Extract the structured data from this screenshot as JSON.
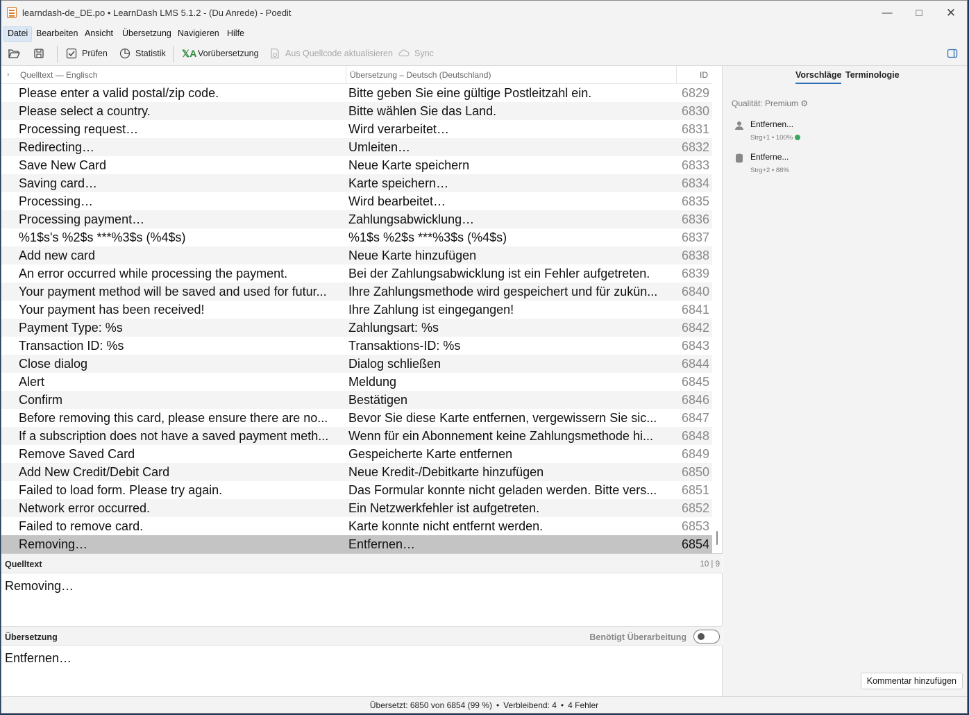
{
  "window": {
    "title": "learndash-de_DE.po • LearnDash LMS 5.1.2 - (Du Anrede) - Poedit"
  },
  "menu": [
    "Datei",
    "Bearbeiten",
    "Ansicht",
    "Übersetzung",
    "Navigieren",
    "Hilfe"
  ],
  "toolbar": {
    "validate": "Prüfen",
    "stats": "Statistik",
    "pretranslate": "Vorübersetzung",
    "update_from_code": "Aus Quellcode aktualisieren",
    "sync": "Sync"
  },
  "list": {
    "col_source": "Quelltext — Englisch",
    "col_translation": "Übersetzung – Deutsch (Deutschland)",
    "col_id": "ID",
    "rows": [
      {
        "source": "Please enter a valid postal/zip code.",
        "translation": "Bitte geben Sie eine gültige Postleitzahl ein.",
        "id": "6829"
      },
      {
        "source": "Please select a country.",
        "translation": "Bitte wählen Sie das Land.",
        "id": "6830"
      },
      {
        "source": "Processing request…",
        "translation": "Wird verarbeitet…",
        "id": "6831"
      },
      {
        "source": "Redirecting…",
        "translation": "Umleiten…",
        "id": "6832"
      },
      {
        "source": "Save New Card",
        "translation": "Neue Karte speichern",
        "id": "6833"
      },
      {
        "source": "Saving card…",
        "translation": "Karte speichern…",
        "id": "6834"
      },
      {
        "source": "Processing…",
        "translation": "Wird bearbeitet…",
        "id": "6835"
      },
      {
        "source": "Processing payment…",
        "translation": "Zahlungsabwicklung…",
        "id": "6836"
      },
      {
        "source": "%1$s's %2$s ***%3$s (%4$s)",
        "translation": "%1$s %2$s ***%3$s (%4$s)",
        "id": "6837"
      },
      {
        "source": "Add new card",
        "translation": "Neue Karte hinzufügen",
        "id": "6838"
      },
      {
        "source": "An error occurred while processing the payment.",
        "translation": "Bei der Zahlungsabwicklung ist ein Fehler aufgetreten.",
        "id": "6839"
      },
      {
        "source": "Your payment method will be saved and used for futur...",
        "translation": "Ihre Zahlungsmethode wird gespeichert und für zukün...",
        "id": "6840"
      },
      {
        "source": "Your payment has been received!",
        "translation": "Ihre Zahlung ist eingegangen!",
        "id": "6841"
      },
      {
        "source": "Payment Type: %s",
        "translation": "Zahlungsart: %s",
        "id": "6842"
      },
      {
        "source": "Transaction ID: %s",
        "translation": "Transaktions-ID: %s",
        "id": "6843"
      },
      {
        "source": "Close dialog",
        "translation": "Dialog schließen",
        "id": "6844"
      },
      {
        "source": "Alert",
        "translation": "Meldung",
        "id": "6845"
      },
      {
        "source": "Confirm",
        "translation": "Bestätigen",
        "id": "6846"
      },
      {
        "source": "Before removing this card, please ensure there are no...",
        "translation": "Bevor Sie diese Karte entfernen, vergewissern Sie sic...",
        "id": "6847"
      },
      {
        "source": "If a subscription does not have a saved payment meth...",
        "translation": "Wenn für ein Abonnement keine Zahlungsmethode hi...",
        "id": "6848"
      },
      {
        "source": "Remove Saved Card",
        "translation": "Gespeicherte Karte entfernen",
        "id": "6849"
      },
      {
        "source": "Add New Credit/Debit Card",
        "translation": "Neue Kredit-/Debitkarte hinzufügen",
        "id": "6850"
      },
      {
        "source": "Failed to load form. Please try again.",
        "translation": "Das Formular konnte nicht geladen werden. Bitte vers...",
        "id": "6851"
      },
      {
        "source": "Network error occurred.",
        "translation": "Ein Netzwerkfehler ist aufgetreten.",
        "id": "6852"
      },
      {
        "source": "Failed to remove card.",
        "translation": "Karte konnte nicht entfernt werden.",
        "id": "6853"
      },
      {
        "source": "Removing…",
        "translation": "Entfernen…",
        "id": "6854"
      }
    ]
  },
  "editor": {
    "source_label": "Quelltext",
    "source_count": "10 | 9",
    "source_text": "Removing…",
    "translation_label": "Übersetzung",
    "fuzzy_label": "Benötigt Überarbeitung",
    "translation_text": "Entfernen…"
  },
  "sidebar": {
    "tab_suggestions": "Vorschläge",
    "tab_terminology": "Terminologie",
    "quality": "Qualität: Premium",
    "suggestions": [
      {
        "text": "Entfernen...",
        "meta": "Strg+1 • 100%"
      },
      {
        "text": "Entferne...",
        "meta": "Strg+2 • 88%"
      }
    ],
    "comment_button": "Kommentar hinzufügen"
  },
  "status": {
    "translated": "Übersetzt: 6850 von 6854 (99 %)",
    "remaining": "Verbleibend: 4",
    "errors": "4 Fehler"
  }
}
